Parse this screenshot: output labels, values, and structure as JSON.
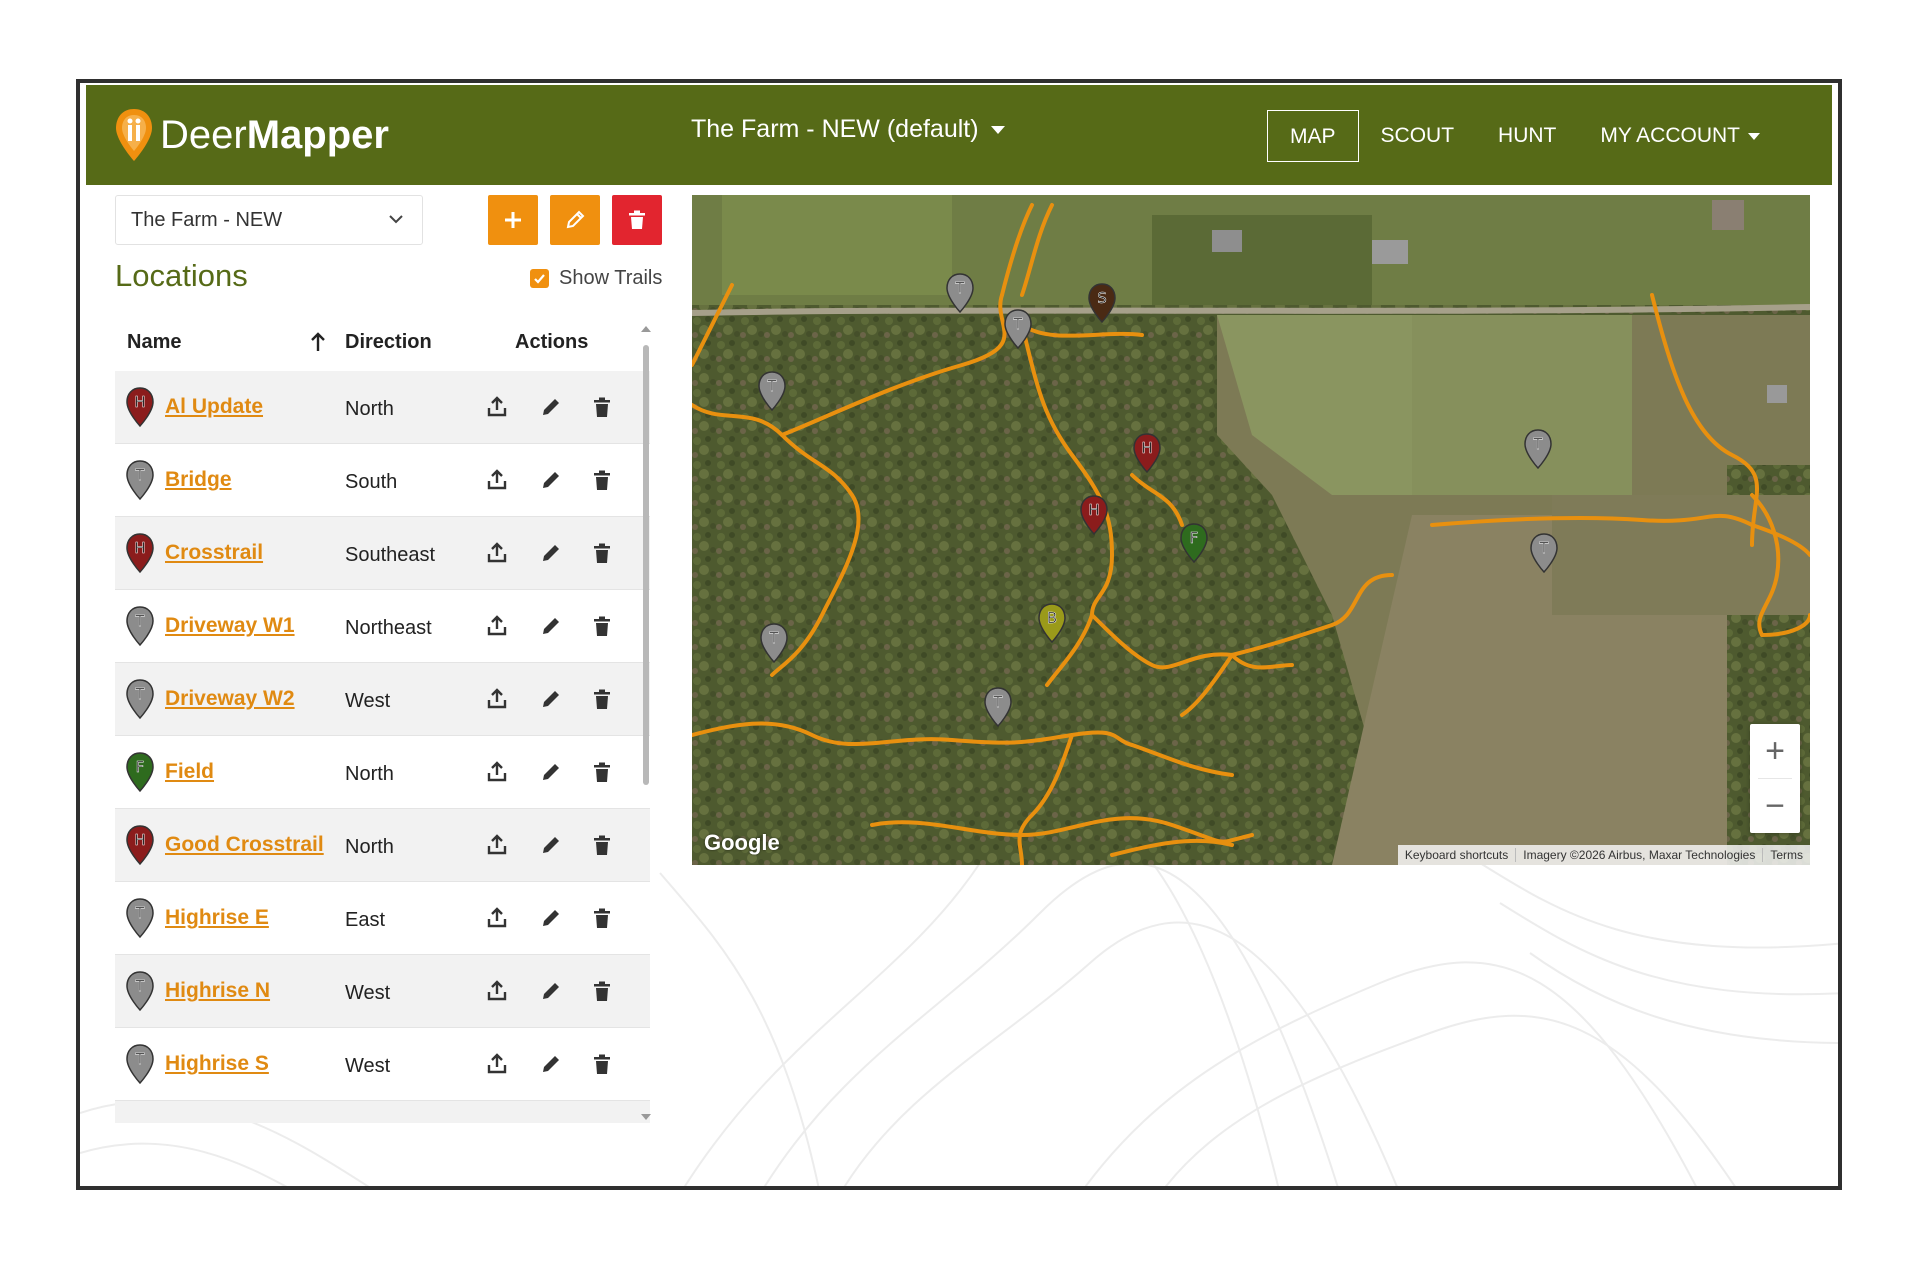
{
  "app": {
    "logo_text_light": "Deer",
    "logo_text_bold": "Mapper"
  },
  "header": {
    "farm_title": "The Farm - NEW (default)",
    "nav": [
      {
        "label": "MAP",
        "active": true
      },
      {
        "label": "SCOUT",
        "active": false
      },
      {
        "label": "HUNT",
        "active": false
      },
      {
        "label": "MY ACCOUNT",
        "active": false,
        "dropdown": true
      }
    ]
  },
  "sidebar": {
    "farm_select_value": "The Farm - NEW",
    "locations_title": "Locations",
    "show_trails_label": "Show Trails",
    "show_trails_checked": true,
    "columns": {
      "name": "Name",
      "direction": "Direction",
      "actions": "Actions"
    },
    "rows": [
      {
        "name": "Al Update",
        "direction": "North",
        "type": "H",
        "color": "#8b1c1c"
      },
      {
        "name": "Bridge",
        "direction": "South",
        "type": "T",
        "color": "#8c8c8c"
      },
      {
        "name": "Crosstrail",
        "direction": "Southeast",
        "type": "H",
        "color": "#8b1c1c"
      },
      {
        "name": "Driveway W1",
        "direction": "Northeast",
        "type": "T",
        "color": "#8c8c8c"
      },
      {
        "name": "Driveway W2",
        "direction": "West",
        "type": "T",
        "color": "#8c8c8c"
      },
      {
        "name": "Field",
        "direction": "North",
        "type": "F",
        "color": "#2e6b1e"
      },
      {
        "name": "Good Crosstrail",
        "direction": "North",
        "type": "H",
        "color": "#8b1c1c"
      },
      {
        "name": "Highrise E",
        "direction": "East",
        "type": "T",
        "color": "#8c8c8c"
      },
      {
        "name": "Highrise N",
        "direction": "West",
        "type": "T",
        "color": "#8c8c8c"
      },
      {
        "name": "Highrise S",
        "direction": "West",
        "type": "T",
        "color": "#8c8c8c"
      }
    ]
  },
  "map": {
    "google_label": "Google",
    "zoom_in": "+",
    "zoom_out": "−",
    "attribution": [
      "Keyboard shortcuts",
      "Imagery ©2026 Airbus, Maxar Technologies",
      "Terms"
    ],
    "markers": [
      {
        "letter": "T",
        "color": "#8c8c8c"
      },
      {
        "letter": "S",
        "color": "#4a2a14"
      },
      {
        "letter": "T",
        "color": "#8c8c8c"
      },
      {
        "letter": "T",
        "color": "#8c8c8c"
      },
      {
        "letter": "H",
        "color": "#8b1c1c"
      },
      {
        "letter": "H",
        "color": "#8b1c1c"
      },
      {
        "letter": "F",
        "color": "#2e6b1e"
      },
      {
        "letter": "T",
        "color": "#8c8c8c"
      },
      {
        "letter": "T",
        "color": "#8c8c8c"
      },
      {
        "letter": "B",
        "color": "#9a9a1a"
      },
      {
        "letter": "T",
        "color": "#8c8c8c"
      },
      {
        "letter": "T",
        "color": "#8c8c8c"
      }
    ]
  },
  "colors": {
    "navbar": "#566a17",
    "accent": "#f0900f",
    "danger": "#e2252f",
    "trail": "#e8900f"
  }
}
